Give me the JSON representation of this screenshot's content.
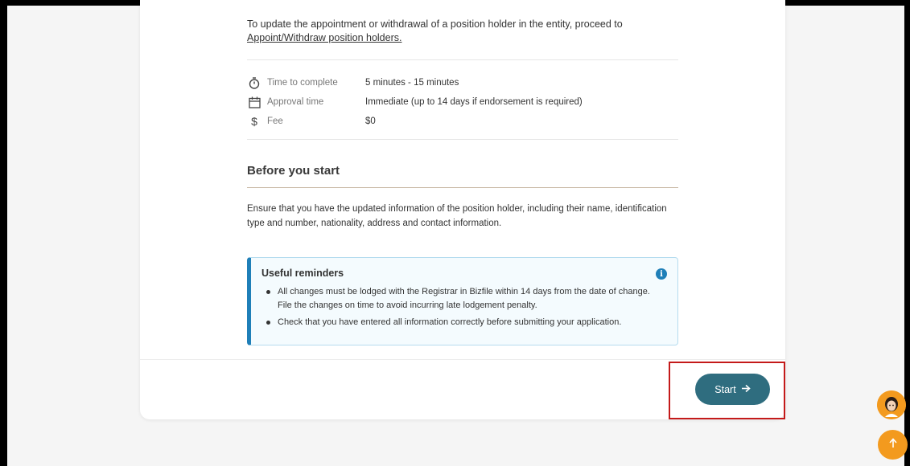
{
  "intro": {
    "text": "To update the appointment or withdrawal of a position holder in the entity, proceed to",
    "link": "Appoint/Withdraw position holders."
  },
  "meta": [
    {
      "icon": "stopwatch-icon",
      "label": "Time to complete",
      "value": "5 minutes - 15 minutes"
    },
    {
      "icon": "calendar-icon",
      "label": "Approval time",
      "value": "Immediate (up to 14 days if endorsement is required)"
    },
    {
      "icon": "dollar-icon",
      "label": "Fee",
      "value": "$0"
    }
  ],
  "before_start": {
    "title": "Before you start",
    "description": "Ensure that you have the updated information of the position holder, including their name, identification type and number, nationality, address and contact information."
  },
  "reminders": {
    "title": "Useful reminders",
    "items": [
      "All changes must be lodged with the Registrar in Bizfile within 14 days from the date of change. File the changes on time to avoid incurring late lodgement penalty.",
      "Check that you have entered all information correctly before submitting your application."
    ]
  },
  "actions": {
    "start_label": "Start",
    "start_icon": "arrow-right-icon"
  },
  "colors": {
    "accent": "#2f6d7f",
    "info": "#1f7fb8",
    "highlight": "#c41a1a",
    "floating": "#f39a1e"
  }
}
